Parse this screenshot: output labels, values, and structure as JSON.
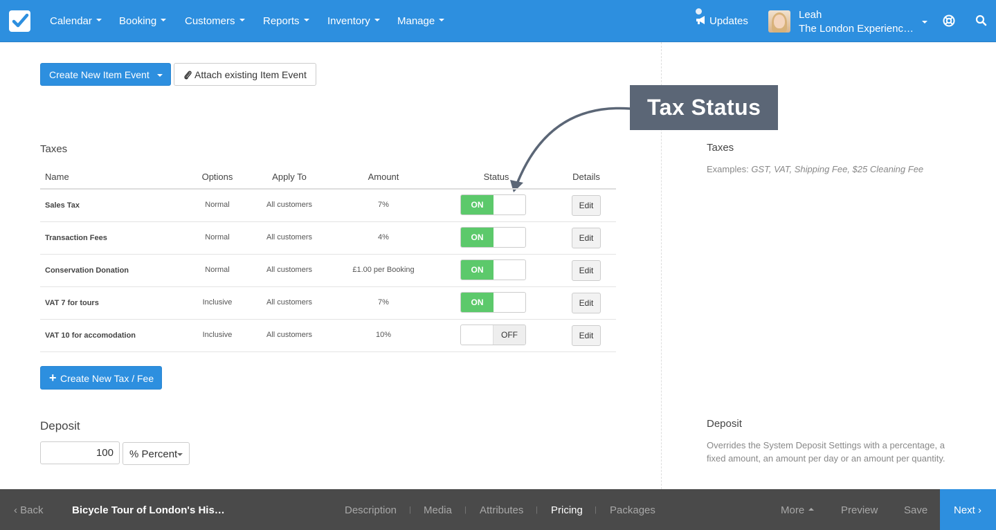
{
  "nav": {
    "items": [
      {
        "label": "Calendar"
      },
      {
        "label": "Booking"
      },
      {
        "label": "Customers"
      },
      {
        "label": "Reports"
      },
      {
        "label": "Inventory"
      },
      {
        "label": "Manage"
      }
    ],
    "updates_label": "Updates",
    "user_name": "Leah",
    "user_company": "The London Experienc…",
    "brand_color": "#2d8fdf"
  },
  "actions": {
    "create_event_label": "Create New Item Event",
    "attach_event_label": "Attach existing Item Event"
  },
  "callout": {
    "label": "Tax Status"
  },
  "taxes": {
    "title": "Taxes",
    "columns": [
      "Name",
      "Options",
      "Apply To",
      "Amount",
      "Status",
      "Details"
    ],
    "rows": [
      {
        "name": "Sales Tax",
        "options": "Normal",
        "apply_to": "All customers",
        "amount": "7%",
        "status": "ON",
        "edit": "Edit"
      },
      {
        "name": "Transaction Fees",
        "options": "Normal",
        "apply_to": "All customers",
        "amount": "4%",
        "status": "ON",
        "edit": "Edit"
      },
      {
        "name": "Conservation Donation",
        "options": "Normal",
        "apply_to": "All customers",
        "amount": "£1.00 per Booking",
        "status": "ON",
        "edit": "Edit"
      },
      {
        "name": "VAT 7 for tours",
        "options": "Inclusive",
        "apply_to": "All customers",
        "amount": "7%",
        "status": "ON",
        "edit": "Edit"
      },
      {
        "name": "VAT 10 for accomodation",
        "options": "Inclusive",
        "apply_to": "All customers",
        "amount": "10%",
        "status": "OFF",
        "edit": "Edit"
      }
    ],
    "create_label": "Create New Tax / Fee"
  },
  "deposit": {
    "title": "Deposit",
    "value": "100",
    "unit": "% Percent"
  },
  "help": {
    "taxes_title": "Taxes",
    "taxes_prefix": "Examples: ",
    "taxes_examples": "GST, VAT, Shipping Fee, $25 Cleaning Fee",
    "deposit_title": "Deposit",
    "deposit_text": "Overrides the System Deposit Settings with a percentage, a fixed amount, an amount per day or an amount per quantity."
  },
  "bottom": {
    "back_label": "Back",
    "item_title": "Bicycle Tour of London's His…",
    "tabs": [
      "Description",
      "Media",
      "Attributes",
      "Pricing",
      "Packages"
    ],
    "active_tab": "Pricing",
    "more_label": "More",
    "preview_label": "Preview",
    "save_label": "Save",
    "next_label": "Next"
  }
}
